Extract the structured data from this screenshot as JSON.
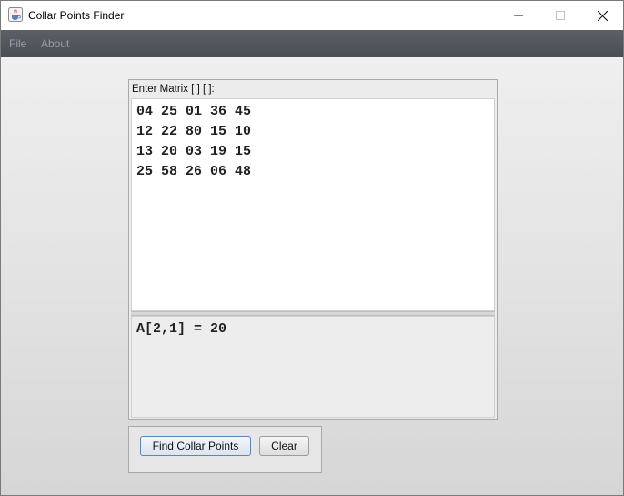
{
  "window": {
    "title": "Collar Points Finder",
    "icon": "java-cup-icon"
  },
  "menu": {
    "items": [
      {
        "label": "File"
      },
      {
        "label": "About"
      }
    ]
  },
  "matrix_panel": {
    "label": "Enter Matrix [ ] [ ]:",
    "rows": [
      "04 25 01 36 45",
      "12 22 80 15 10",
      "13 20 03 19 15",
      "25 58 26 06 48"
    ]
  },
  "result": {
    "text": "A[2,1] = 20"
  },
  "buttons": {
    "find": "Find Collar Points",
    "clear": "Clear"
  },
  "colors": {
    "menubar": "#55585f",
    "menu_text": "#9a9da3",
    "primary_border": "#5b86b8"
  }
}
